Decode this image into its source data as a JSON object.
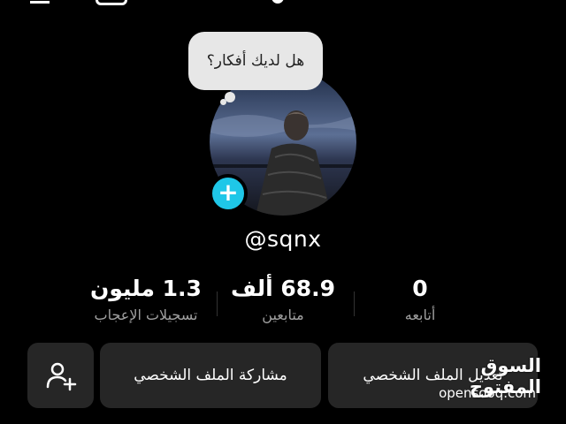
{
  "top_bar": {
    "icons": [
      "menu-icon",
      "calendar-icon",
      "profile-dot-icon"
    ]
  },
  "bubble": {
    "text": "هل لديك أفكار؟"
  },
  "profile": {
    "username": "@sqnx",
    "avatar_icon": "profile-photo",
    "add_icon": "plus-icon"
  },
  "stats": {
    "following": {
      "value": "0",
      "label": "أتابعه"
    },
    "followers": {
      "value": "68.9 ألف",
      "label": "متابعين"
    },
    "likes": {
      "value": "1.3 مليون",
      "label": "تسجيلات الإعجاب"
    }
  },
  "buttons": {
    "edit_profile": "تعديل الملف الشخصي",
    "share_profile": "مشاركة الملف الشخصي",
    "add_friend_icon": "add-user-icon"
  },
  "watermark": {
    "arabic": "السوق المفتوح",
    "latin": "opensooq.com"
  },
  "colors": {
    "background": "#000000",
    "accent": "#1fc7e8",
    "button_bg": "#262626",
    "secondary_text": "#a0a0a0"
  }
}
